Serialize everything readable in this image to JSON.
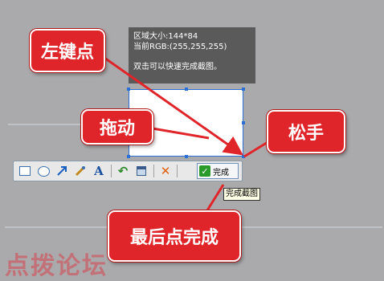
{
  "info_panel": {
    "size_line": "区域大小:144*84",
    "rgb_line": "当前RGB:(255,255,255)",
    "hint_line": "双击可以快速完成截图。"
  },
  "callouts": {
    "left_click": "左键点",
    "drag": "拖动",
    "release": "松手",
    "finish": "最后点完成"
  },
  "toolbar": {
    "tools": [
      "rectangle-icon",
      "ellipse-icon",
      "arrow-icon",
      "brush-icon",
      "text-icon",
      "undo-icon",
      "save-icon",
      "cancel-icon"
    ],
    "finish_label": "完成"
  },
  "tooltip": "完成截图",
  "watermark": "点拨论坛",
  "colors": {
    "callout": "#e0252a",
    "selection": "#2a6fd6",
    "arrow": "#e0252a"
  }
}
